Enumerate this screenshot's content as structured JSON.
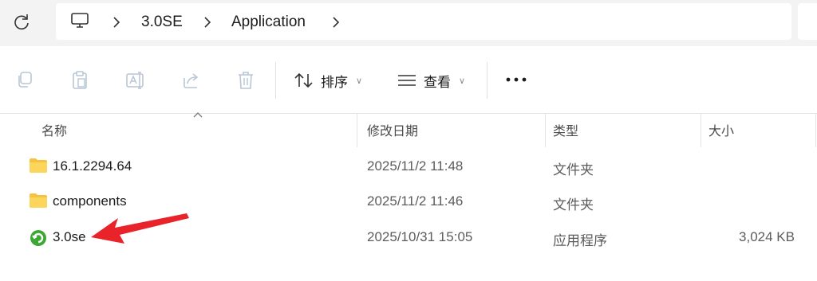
{
  "address_bar": {
    "breadcrumbs": [
      "3.0SE",
      "Application"
    ]
  },
  "toolbar": {
    "sort_label": "排序",
    "view_label": "查看"
  },
  "columns": {
    "name": "名称",
    "modified": "修改日期",
    "type": "类型",
    "size": "大小"
  },
  "files": [
    {
      "name": "16.1.2294.64",
      "modified": "2025/11/2 11:48",
      "type": "文件夹",
      "size": "",
      "icon": "folder-icon"
    },
    {
      "name": "components",
      "modified": "2025/11/2 11:46",
      "type": "文件夹",
      "size": "",
      "icon": "folder-icon"
    },
    {
      "name": "3.0se",
      "modified": "2025/10/31 15:05",
      "type": "应用程序",
      "size": "3,024 KB",
      "icon": "app-icon"
    }
  ],
  "colors": {
    "folder": "#f5c242",
    "arrow": "#e8232a",
    "app_green": "#3aa833"
  }
}
